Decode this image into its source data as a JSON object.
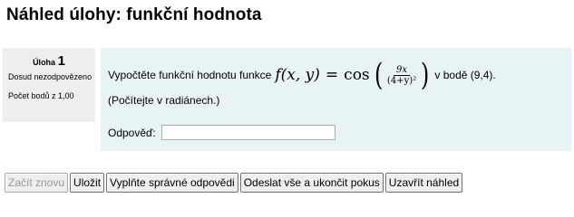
{
  "page": {
    "title": "Náhled úlohy: funkční hodnota"
  },
  "question_info": {
    "label": "Úloha",
    "number": "1",
    "state": "Dosud nezodpovězeno",
    "grade": "Počet bodů z 1,00"
  },
  "question": {
    "text_before": "Vypočtěte funkční hodnotu funkce",
    "formula": {
      "lhs": "f(x, y)",
      "eq": "=",
      "func": "cos",
      "numerator": "9x",
      "denominator": "(4+y)²"
    },
    "text_after": "v bodě (9,4).",
    "note": "(Počítejte v radiánech.)",
    "answer_label": "Odpověď:",
    "answer_value": ""
  },
  "buttons": {
    "restart": "Začít znovu",
    "save": "Uložit",
    "fill_correct": "Vyplňte správné odpovědi",
    "submit_all": "Odeslat vše a ukončit  pokus",
    "close_preview": "Uzavřít náhled"
  }
}
